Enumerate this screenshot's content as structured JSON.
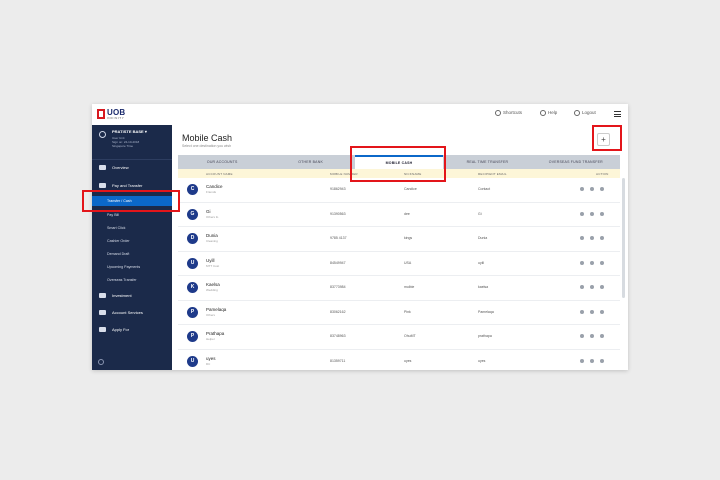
{
  "topbar": {
    "logo_text": "UOB",
    "logo_sub": "INFINITY",
    "items": [
      "Shortcuts",
      "Help",
      "Logout"
    ],
    "icons": [
      "shortcuts-icon",
      "help-icon",
      "logout-icon",
      "menu-icon"
    ]
  },
  "sidebar": {
    "profile": {
      "name": "PRATISTE BASE ▾",
      "lines": [
        "User Unit",
        "Sign on: 24-10-2018",
        "Singapore Time"
      ]
    },
    "nav": [
      {
        "label": "Overview",
        "icon": "overview-icon"
      },
      {
        "label": "Pay and Transfer",
        "icon": "transfer-icon"
      },
      {
        "label": "Investment",
        "icon": "investment-icon"
      },
      {
        "label": "Account Services",
        "icon": "services-icon"
      },
      {
        "label": "Apply For",
        "icon": "apply-icon"
      }
    ],
    "sub_items": [
      "Transfer / Cash",
      "Pay Bill",
      "Smart Click",
      "Cashier Order",
      "Demand Draft",
      "Upcoming Payments",
      "Overseas Transfer"
    ]
  },
  "main": {
    "title": "Mobile Cash",
    "subtitle": "Select one destination you wish",
    "add_label": "+",
    "tabs": [
      "OUR ACCOUNTS",
      "OTHER BANK",
      "MOBILE CASH",
      "REAL TIME TRANSFER",
      "OVERSEAS FUND TRANSFER"
    ],
    "active_tab": 2,
    "columns": [
      "ACCOUNT NAME",
      "MOBILE NUMBER",
      "NICKNAME",
      "RECIPIENT EMAIL",
      "ACTION"
    ],
    "rows": [
      {
        "initial": "C",
        "name": "Candice",
        "sub": "Friends",
        "mobile": "91862943",
        "nickname": "Candice",
        "email": "Contact"
      },
      {
        "initial": "G",
        "name": "Gi",
        "sub": "Others fo",
        "mobile": "91390563",
        "nickname": "dee",
        "email": "Gi"
      },
      {
        "initial": "D",
        "name": "Dunia",
        "sub": "Cleaning",
        "mobile": "9785 4137",
        "nickname": "kings",
        "email": "Dunia"
      },
      {
        "initial": "U",
        "name": "Uyill",
        "sub": "MTT Cost",
        "mobile": "84549947",
        "nickname": "USA",
        "email": "uyill"
      },
      {
        "initial": "K",
        "name": "Kaelsa",
        "sub": "Wedding",
        "mobile": "83773984",
        "nickname": "mulbie",
        "email": "kaelsa"
      },
      {
        "initial": "P",
        "name": "Pamelaqa",
        "sub": "Others",
        "mobile": "83062162",
        "nickname": "Pink",
        "email": "Pamelaqa"
      },
      {
        "initial": "P",
        "name": "Prathapa",
        "sub": "Helper",
        "mobile": "83748963",
        "nickname": "OhuMT",
        "email": "prathapa"
      },
      {
        "initial": "U",
        "name": "uyes",
        "sub": "DC",
        "mobile": "81359711",
        "nickname": "uyes",
        "email": "uyes"
      }
    ]
  },
  "colors": {
    "sidebar": "#1b2a4a",
    "accent": "#0b68c9",
    "highlight": "#e3151a",
    "brand_red": "#d71920"
  }
}
